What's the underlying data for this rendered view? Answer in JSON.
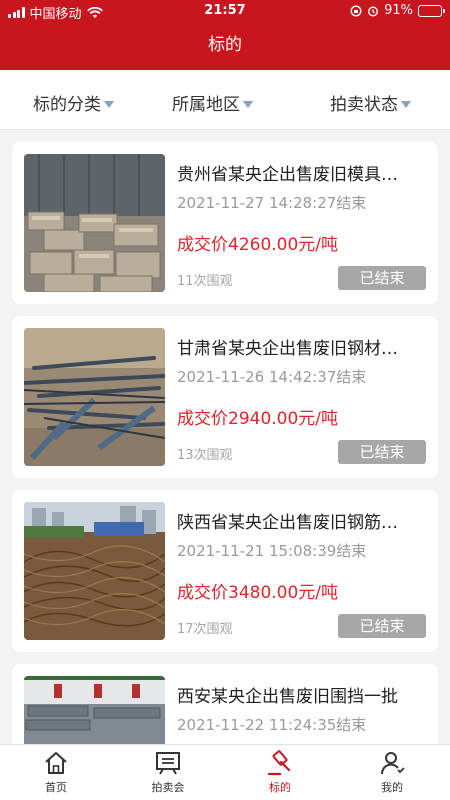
{
  "statusbar": {
    "carrier": "中国移动",
    "time": "21:57",
    "battery": "91%",
    "battery_level": 0.91
  },
  "header": {
    "title": "标的"
  },
  "filters": [
    "标的分类",
    "所属地区",
    "拍卖状态"
  ],
  "items": [
    {
      "title": "贵州省某央企出售废旧模具…",
      "time": "2021-11-27 14:28:27结束",
      "price": "成交价4260.00元/吨",
      "views": "11次围观",
      "status": "已结束"
    },
    {
      "title": "甘肃省某央企出售废旧钢材…",
      "time": "2021-11-26 14:42:37结束",
      "price": "成交价2940.00元/吨",
      "views": "13次围观",
      "status": "已结束"
    },
    {
      "title": "陕西省某央企出售废旧钢筋…",
      "time": "2021-11-21 15:08:39结束",
      "price": "成交价3480.00元/吨",
      "views": "17次围观",
      "status": "已结束"
    },
    {
      "title": "西安某央企出售废旧围挡一批",
      "time": "2021-11-22 11:24:35结束",
      "price": "",
      "views": "",
      "status": ""
    }
  ],
  "tabs": [
    {
      "label": "首页",
      "icon": "home-icon"
    },
    {
      "label": "拍卖会",
      "icon": "auction-board-icon"
    },
    {
      "label": "标的",
      "icon": "gavel-icon",
      "active": true
    },
    {
      "label": "我的",
      "icon": "user-icon"
    }
  ],
  "colors": {
    "brand": "#c7161e",
    "price": "#e0242b",
    "badge": "#a7a7a7"
  }
}
